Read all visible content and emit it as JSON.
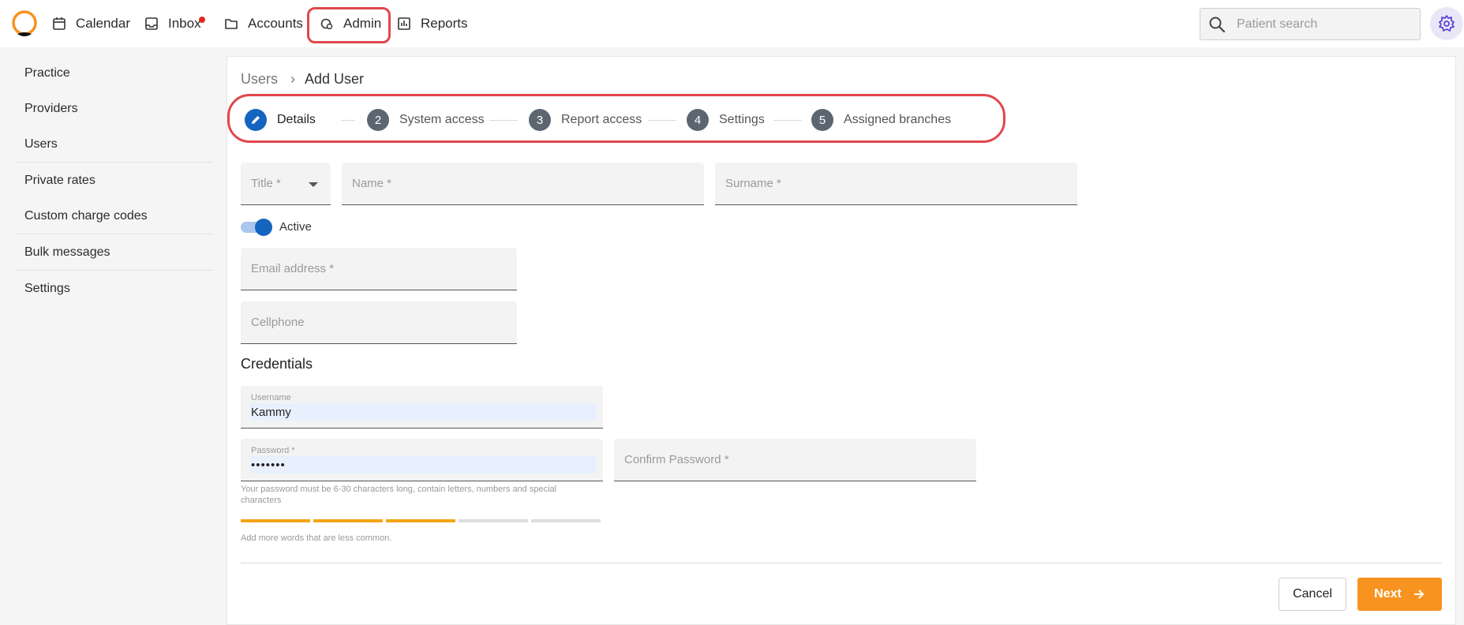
{
  "nav": {
    "calendar": "Calendar",
    "inbox": "Inbox",
    "accounts": "Accounts",
    "admin": "Admin",
    "reports": "Reports"
  },
  "search": {
    "placeholder": "Patient search"
  },
  "sidebar": {
    "items": [
      {
        "label": "Practice"
      },
      {
        "label": "Providers"
      },
      {
        "label": "Users"
      },
      {
        "label": "Private rates"
      },
      {
        "label": "Custom charge codes"
      },
      {
        "label": "Bulk messages"
      },
      {
        "label": "Settings"
      }
    ]
  },
  "breadcrumb": {
    "parent": "Users",
    "current": "Add User"
  },
  "steps": [
    {
      "num": "",
      "label": "Details"
    },
    {
      "num": "2",
      "label": "System access"
    },
    {
      "num": "3",
      "label": "Report access"
    },
    {
      "num": "4",
      "label": "Settings"
    },
    {
      "num": "5",
      "label": "Assigned branches"
    }
  ],
  "form": {
    "title_label": "Title *",
    "name_label": "Name *",
    "surname_label": "Surname *",
    "active_label": "Active",
    "email_label": "Email address *",
    "cellphone_label": "Cellphone",
    "credentials_heading": "Credentials",
    "username_label": "Username",
    "username_value": "Kammy",
    "password_label": "Password *",
    "password_value": "•••••••",
    "confirm_password_label": "Confirm Password *",
    "password_hint": "Your password must be 6-30 characters long, contain letters, numbers and special characters",
    "strength_hint": "Add more words that are less common.",
    "strength_level": 3,
    "strength_max": 5
  },
  "footer": {
    "cancel": "Cancel",
    "next": "Next"
  },
  "colors": {
    "accent": "#f7931e",
    "primary": "#1565c0",
    "highlight": "#e0474c",
    "strength_filled": "#f5a516",
    "strength_empty": "#dddddd"
  }
}
